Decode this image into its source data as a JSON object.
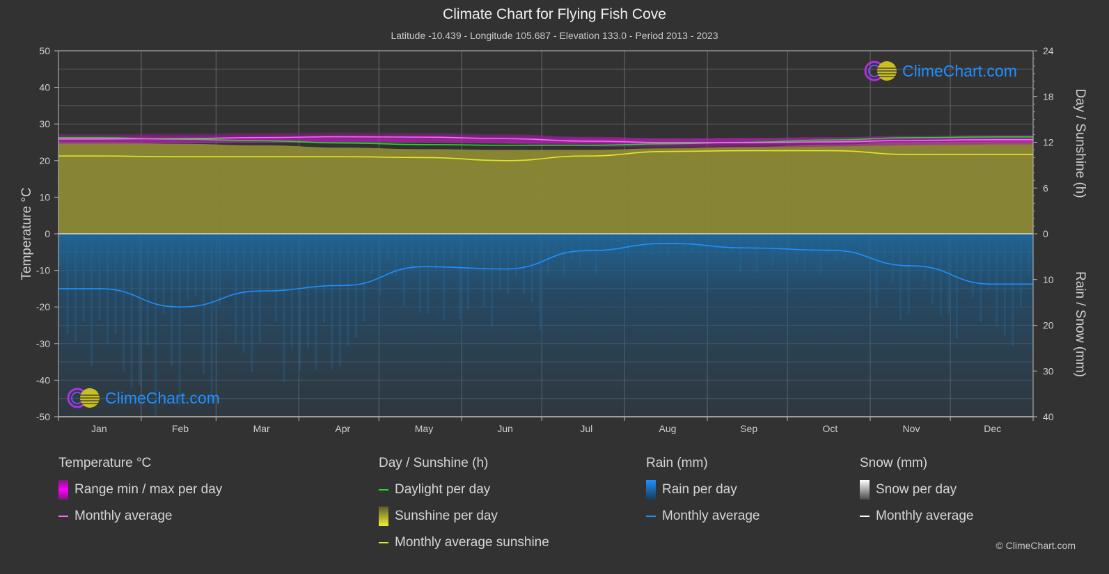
{
  "header": {
    "title": "Climate Chart for Flying Fish Cove",
    "subtitle": "Latitude -10.439 - Longitude 105.687 - Elevation 133.0 - Period 2013 - 2023"
  },
  "logo": {
    "text": "ClimeChart.com"
  },
  "copyright": "© ClimeChart.com",
  "colors": {
    "background": "#323232",
    "temp_range": "#d400d4",
    "temp_avg": "#ff66ff",
    "daylight": "#22dd22",
    "sunshine_fill": "#8c8a34",
    "sunshine_avg": "#e6e62a",
    "rain_fill": "#1f5a86",
    "rain_avg": "#1e90ff",
    "snow": "#ffffff",
    "logo_text": "#1e90ff"
  },
  "legend": {
    "groups": [
      {
        "title": "Temperature °C",
        "items": [
          {
            "label": "Range min / max per day",
            "swatch": "box-magenta"
          },
          {
            "label": "Monthly average",
            "swatch": "line-pink"
          }
        ]
      },
      {
        "title": "Day / Sunshine (h)",
        "items": [
          {
            "label": "Daylight per day",
            "swatch": "line-green"
          },
          {
            "label": "Sunshine per day",
            "swatch": "box-yellow"
          },
          {
            "label": "Monthly average sunshine",
            "swatch": "line-yellow"
          }
        ]
      },
      {
        "title": "Rain (mm)",
        "items": [
          {
            "label": "Rain per day",
            "swatch": "box-blue"
          },
          {
            "label": "Monthly average",
            "swatch": "line-blue"
          }
        ]
      },
      {
        "title": "Snow (mm)",
        "items": [
          {
            "label": "Snow per day",
            "swatch": "box-white"
          },
          {
            "label": "Monthly average",
            "swatch": "line-white"
          }
        ]
      }
    ]
  },
  "chart_data": {
    "type": "line",
    "title": "Climate Chart for Flying Fish Cove",
    "categories": [
      "Jan",
      "Feb",
      "Mar",
      "Apr",
      "May",
      "Jun",
      "Jul",
      "Aug",
      "Sep",
      "Oct",
      "Nov",
      "Dec"
    ],
    "left_axis": {
      "label": "Temperature °C",
      "range": [
        -50,
        50
      ],
      "ticks": [
        50,
        40,
        30,
        20,
        10,
        0,
        -10,
        -20,
        -30,
        -40,
        -50
      ]
    },
    "right_axis_top": {
      "label": "Day / Sunshine (h)",
      "range": [
        0,
        24
      ],
      "ticks": [
        24,
        18,
        12,
        6,
        0
      ]
    },
    "right_axis_bottom": {
      "label": "Rain / Snow (mm)",
      "range": [
        0,
        40
      ],
      "ticks": [
        0,
        10,
        20,
        30,
        40
      ]
    },
    "grid": true,
    "series": [
      {
        "name": "Temperature monthly average (°C)",
        "axis": "left",
        "values": [
          25.9,
          26.0,
          26.3,
          26.5,
          26.4,
          26.0,
          25.3,
          24.9,
          24.9,
          25.1,
          25.5,
          25.7
        ]
      },
      {
        "name": "Temperature range max (°C)",
        "axis": "left",
        "values": [
          27.2,
          27.4,
          27.6,
          27.7,
          27.6,
          27.2,
          26.5,
          26.1,
          26.2,
          26.4,
          26.8,
          27.0
        ]
      },
      {
        "name": "Temperature range min (°C)",
        "axis": "left",
        "values": [
          24.6,
          24.7,
          24.9,
          25.1,
          25.0,
          24.6,
          23.9,
          23.5,
          23.6,
          23.8,
          24.2,
          24.4
        ]
      },
      {
        "name": "Daylight per day (h)",
        "axis": "right_top",
        "values": [
          12.6,
          12.4,
          12.2,
          11.9,
          11.7,
          11.6,
          11.6,
          11.8,
          12.0,
          12.3,
          12.6,
          12.7
        ]
      },
      {
        "name": "Monthly average sunshine (h)",
        "axis": "right_top",
        "values": [
          10.2,
          10.1,
          10.1,
          10.1,
          10.0,
          9.6,
          10.2,
          10.8,
          10.9,
          10.9,
          10.4,
          10.4
        ]
      },
      {
        "name": "Rain monthly average (mm)",
        "axis": "right_bottom",
        "values": [
          12.0,
          16.0,
          12.5,
          11.3,
          7.2,
          7.7,
          3.7,
          2.1,
          3.1,
          3.6,
          7.0,
          11.0
        ]
      },
      {
        "name": "Snow monthly average (mm)",
        "axis": "right_bottom",
        "values": [
          0,
          0,
          0,
          0,
          0,
          0,
          0,
          0,
          0,
          0,
          0,
          0
        ]
      }
    ]
  }
}
